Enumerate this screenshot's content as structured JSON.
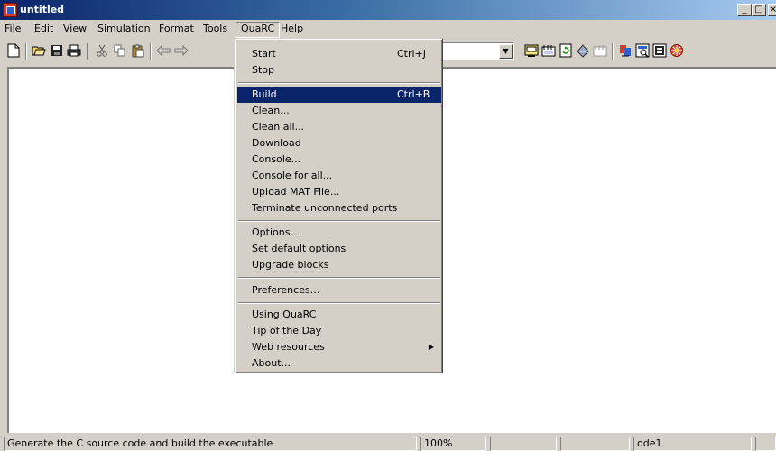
{
  "window": {
    "title": "untitled",
    "minimize_glyph": "_",
    "maximize_glyph": "□",
    "close_glyph": "×"
  },
  "menubar": [
    "File",
    "Edit",
    "View",
    "Simulation",
    "Format",
    "Tools",
    "QuaRC",
    "Help"
  ],
  "toolbar": {
    "icons": [
      "new-icon",
      "open-icon",
      "save-icon",
      "print-icon",
      "cut-icon",
      "copy-icon",
      "paste-icon",
      "back-icon",
      "forward-icon",
      "build-icon",
      "library-icon",
      "update-icon",
      "debug-icon",
      "model-explorer-icon",
      "target-icon",
      "run-icon",
      "browser-icon",
      "config-icon",
      "quarc-icon"
    ],
    "simulation_mode": ""
  },
  "quarc_menu": {
    "groups": [
      [
        {
          "label": "Start",
          "shortcut": "Ctrl+J"
        },
        {
          "label": "Stop"
        }
      ],
      [
        {
          "label": "Build",
          "shortcut": "Ctrl+B",
          "highlighted": true
        },
        {
          "label": "Clean..."
        },
        {
          "label": "Clean all..."
        },
        {
          "label": "Download"
        },
        {
          "label": "Console..."
        },
        {
          "label": "Console for all..."
        },
        {
          "label": "Upload MAT File..."
        },
        {
          "label": "Terminate unconnected ports"
        }
      ],
      [
        {
          "label": "Options..."
        },
        {
          "label": "Set default options"
        },
        {
          "label": "Upgrade blocks"
        }
      ],
      [
        {
          "label": "Preferences..."
        }
      ],
      [
        {
          "label": "Using QuaRC"
        },
        {
          "label": "Tip of the Day"
        },
        {
          "label": "Web resources",
          "submenu": true
        },
        {
          "label": "About..."
        }
      ]
    ]
  },
  "statusbar": {
    "message": "Generate the C source code and build the executable",
    "zoom": "100%",
    "cell_3": "",
    "cell_4": "",
    "solver": "ode1"
  },
  "colors": {
    "title_start": "#0a246a",
    "title_end": "#a6caf0",
    "highlight": "#0a246a",
    "face": "#d4d0c8"
  }
}
